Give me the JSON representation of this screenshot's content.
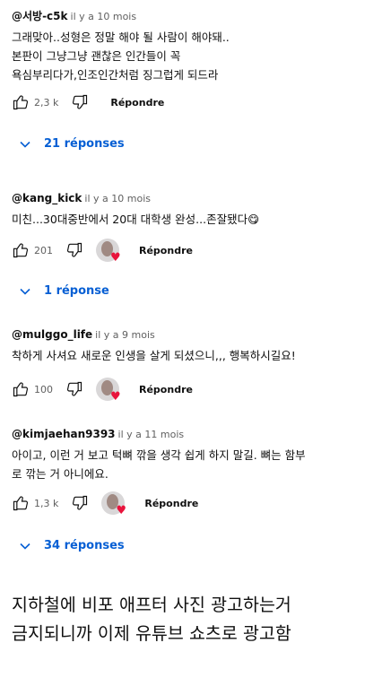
{
  "comments": [
    {
      "author": "@서방-c5k",
      "time": "il y a 10 mois",
      "text_lines": [
        "그래맞아..성형은 정말 해야 될 사람이 해야돼..",
        "본판이 그냥그냥 괜찮은 인간들이 꼭",
        "욕심부리다가,인조인간처럼 징그럽게 되드라"
      ],
      "likes": "2,3 k",
      "reply_label": "Répondre",
      "replies_label": "21 réponses"
    },
    {
      "author": "@kang_kick",
      "time": "il y a 10 mois",
      "text_lines": [
        "미친...30대중반에서 20대 대학생 완성...존잘됐다😋"
      ],
      "likes": "201",
      "reply_label": "Répondre",
      "replies_label": "1 réponse"
    },
    {
      "author": "@mulggo_life",
      "time": "il y a 9 mois",
      "text_lines": [
        "착하게 사셔요 새로운 인생을 살게 되셨으니,,, 행복하시길요!"
      ],
      "likes": "100",
      "reply_label": "Répondre"
    },
    {
      "author": "@kimjaehan9393",
      "time": "il y a 11 mois",
      "text_lines": [
        "아이고, 이런 거 보고 턱뼈 깎을 생각 쉽게 하지 말길. 뼈는 함부",
        "로 깎는 거 아니에요."
      ],
      "likes": "1,3 k",
      "reply_label": "Répondre",
      "replies_label": "34 réponses"
    }
  ],
  "caption_lines": [
    "지하철에 비포 애프터 사진 광고하는거",
    "금지되니까 이제 유튜브 쇼츠로 광고함"
  ],
  "colors": {
    "link": "#065fd4",
    "heart": "#e8143c"
  }
}
